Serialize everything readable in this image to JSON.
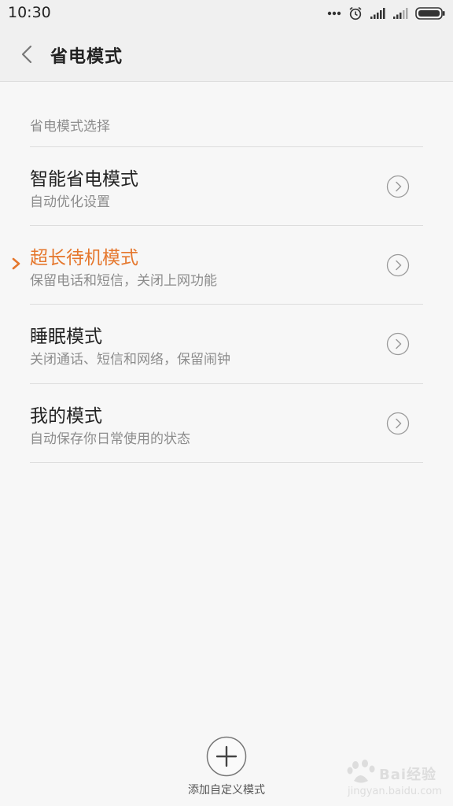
{
  "status_bar": {
    "time": "10:30",
    "icons": [
      "more-dots-icon",
      "alarm-icon",
      "signal-icon",
      "signal-icon",
      "battery-icon"
    ]
  },
  "header": {
    "title": "省电模式",
    "back_icon": "chevron-left-icon"
  },
  "section": {
    "label": "省电模式选择"
  },
  "modes": [
    {
      "title": "智能省电模式",
      "description": "自动优化设置",
      "selected": false
    },
    {
      "title": "超长待机模式",
      "description": "保留电话和短信，关闭上网功能",
      "selected": true
    },
    {
      "title": "睡眠模式",
      "description": "关闭通话、短信和网络，保留闹钟",
      "selected": false
    },
    {
      "title": "我的模式",
      "description": "自动保存你日常使用的状态",
      "selected": false
    }
  ],
  "footer": {
    "add_label": "添加自定义模式",
    "add_icon": "plus-icon"
  },
  "watermark": {
    "text": "Bai经验",
    "sub": "jingyan.baidu.com"
  },
  "colors": {
    "accent": "#e5772d",
    "background": "#f7f7f7",
    "header_bg": "#f0f0f0",
    "text_primary": "#222222",
    "text_secondary": "#8c8c8c",
    "divider": "#dddddd"
  }
}
